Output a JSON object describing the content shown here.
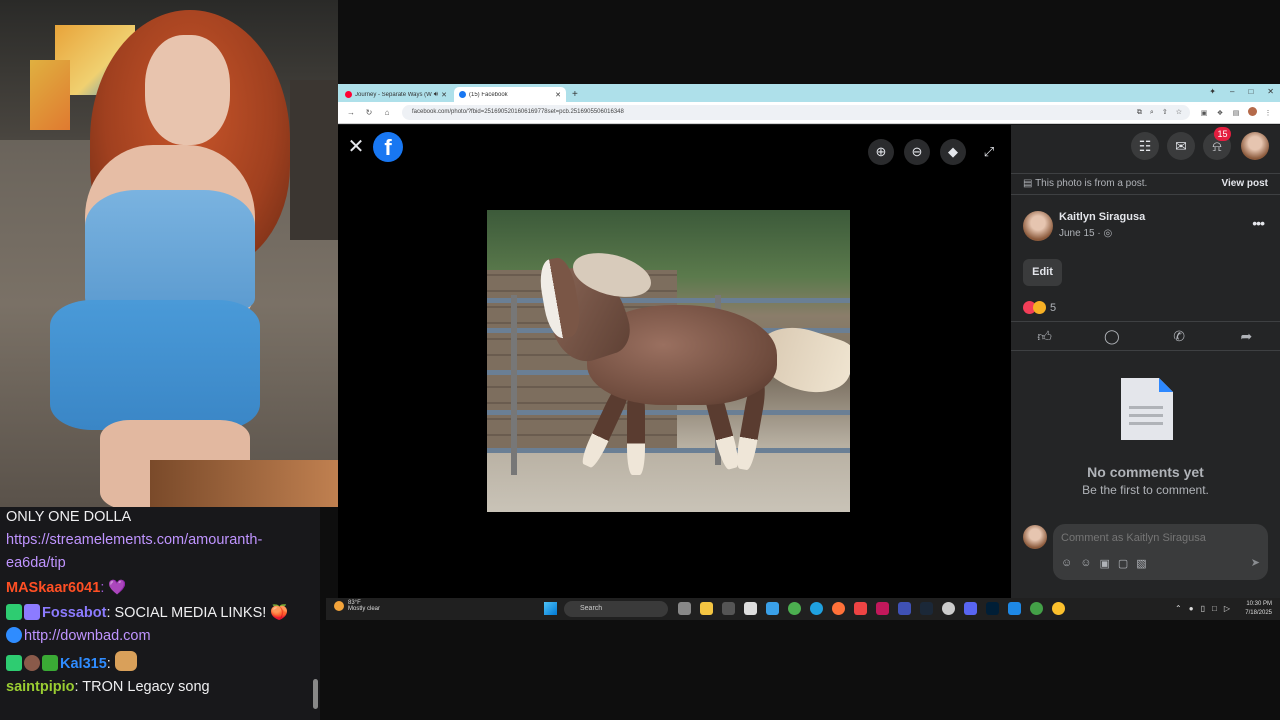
{
  "chat": {
    "messages": [
      {
        "user": "",
        "text": "ONLY ONE DOLLA"
      },
      {
        "user": "",
        "link": "https://streamelements.com/amouranth-",
        "link2": "ea6da/tip"
      },
      {
        "user": "MASkaar6041",
        "user_color": "#ff4f24",
        "text": ": 💜"
      },
      {
        "user": "Fossabot",
        "user_color": "#8c7bff",
        "text": ": SOCIAL MEDIA LINKS! 🍑"
      },
      {
        "user": "",
        "link": "http://downbad.com"
      },
      {
        "user": "Kal315",
        "user_color": "#2f8cff",
        "text": ":"
      },
      {
        "user": "saintpipio",
        "user_color": "#9acd32",
        "text": ": TRON Legacy song"
      }
    ]
  },
  "browser": {
    "tabs": [
      {
        "label": "Journey - Separate Ways (W",
        "active": false,
        "favicon_color": "#ff0033"
      },
      {
        "label": "(15) Facebook",
        "active": true,
        "favicon_color": "#1877f2"
      }
    ],
    "new_tab": "+",
    "url": "facebook.com/photo/?fbid=2516905201606169778set=pcb.2516905506016348"
  },
  "viewer": {
    "close": "✕",
    "logo": "f",
    "tools": [
      "zoom-in",
      "zoom-out",
      "tag",
      "fullscreen"
    ]
  },
  "panel": {
    "notification_count": "15",
    "from_post_text": "This photo is from a post.",
    "view_post": "View post",
    "author": "Kaitlyn Siragusa",
    "date": "June 15 ·",
    "edit": "Edit",
    "reaction_count": "5",
    "no_comments_title": "No comments yet",
    "no_comments_sub": "Be the first to comment.",
    "comment_placeholder": "Comment as Kaitlyn Siragusa"
  },
  "taskbar": {
    "temp": "83°F",
    "weather": "Mostly clear",
    "search": "Search",
    "time": "10:30 PM",
    "date": "7/18/2025"
  }
}
